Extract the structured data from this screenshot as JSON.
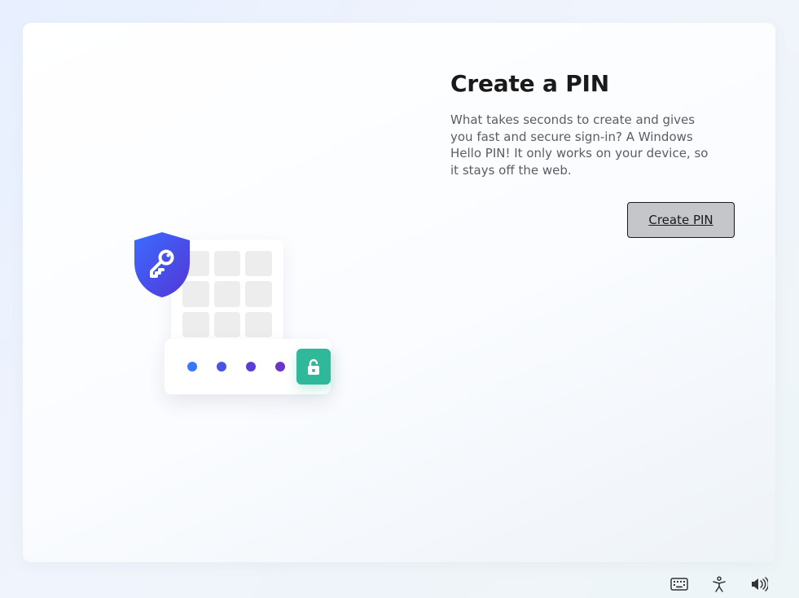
{
  "page": {
    "title": "Create a PIN",
    "description": "What takes seconds to create and gives you fast and secure sign-in? A Windows Hello PIN! It only works on your device, so it stays off the web.",
    "primary_button_label": "Create PIN"
  },
  "illustration": {
    "shield_icon": "shield-key",
    "pin_dots": 4,
    "pinpad_keys": 9,
    "unlock_icon": "unlock"
  },
  "taskbar": {
    "icons": [
      {
        "name": "keyboard-icon"
      },
      {
        "name": "accessibility-icon"
      },
      {
        "name": "volume-icon"
      }
    ]
  },
  "colors": {
    "accent_blue": "#3679ff",
    "accent_purple": "#5c3ed6",
    "unlock_green": "#2fb899",
    "button_bg": "#c4c6c9"
  }
}
